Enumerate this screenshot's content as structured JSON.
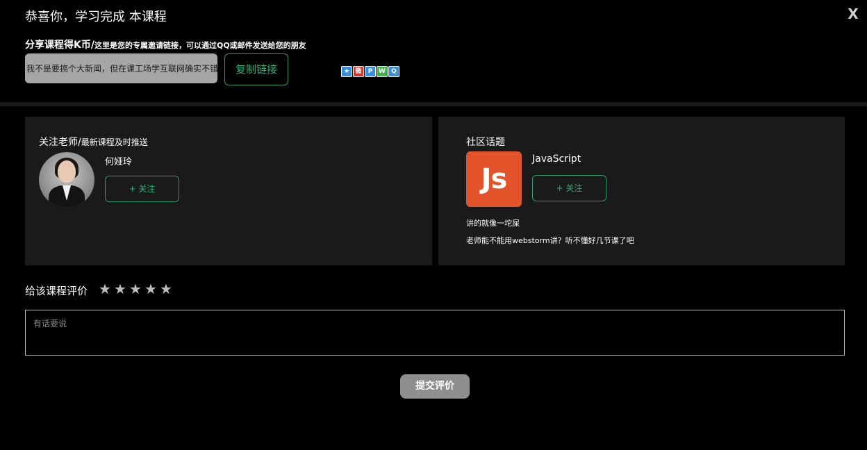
{
  "header": {
    "title": "恭喜你，学习完成 本课程",
    "close_label": "X"
  },
  "share": {
    "main_label": "分享课程得K币/",
    "sub_label": "这里是您的专属邀请链接，可以通过QQ或邮件发送给您的朋友",
    "link_value": "我不是要搞个大新闻，但在课工场学互联网确实不错",
    "copy_button": "复制链接",
    "icons": [
      {
        "name": "qzone-icon",
        "glyph": "★",
        "color": "#3a8fd8"
      },
      {
        "name": "weibo-icon",
        "glyph": "微",
        "color": "#d9332b"
      },
      {
        "name": "tencent-weibo-icon",
        "glyph": "P",
        "color": "#3a8fd8"
      },
      {
        "name": "wechat-icon",
        "glyph": "W",
        "color": "#3bb54a"
      },
      {
        "name": "qq-icon",
        "glyph": "Q",
        "color": "#3a8fd8"
      }
    ]
  },
  "teacher": {
    "heading": "关注老师/",
    "heading_small": "最新课程及时推送",
    "name": "何娅玲",
    "follow_button": "+ 关注"
  },
  "community": {
    "heading": "社区话题",
    "logo_text": "Js",
    "logo_color": "#e4542a",
    "topic_name": "JavaScript",
    "follow_button": "+ 关注",
    "posts": [
      "讲的就像一坨屎",
      "老师能不能用webstorm讲？听不懂好几节课了吧"
    ]
  },
  "rating": {
    "label": "给该课程评价",
    "stars": [
      "★",
      "★",
      "★",
      "★",
      "★"
    ],
    "comment_placeholder": "有话要说",
    "submit_button": "提交评价"
  },
  "colors": {
    "accent_green": "#2fae78",
    "card_bg": "#1a1a1a",
    "submit_bg": "#8e8e8e"
  }
}
